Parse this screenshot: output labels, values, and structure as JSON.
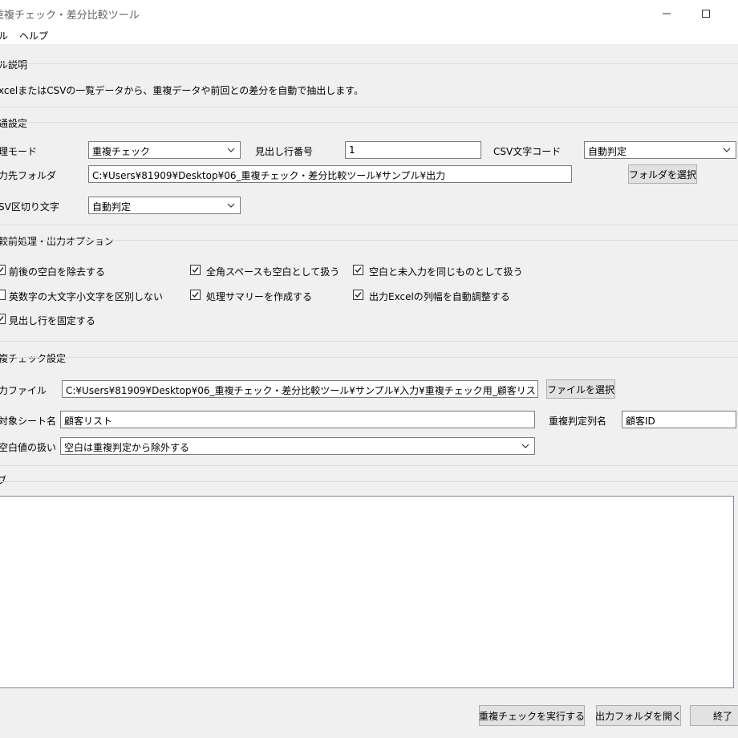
{
  "window": {
    "title": "重複チェック・差分比較ツール"
  },
  "menu": {
    "items": [
      "ル",
      "ヘルプ"
    ]
  },
  "description": {
    "title": "ル説明",
    "text": "xcelまたはCSVの一覧データから、重複データや前回との差分を自動で抽出します。"
  },
  "common": {
    "title": "通設定",
    "mode_label": "理モード",
    "mode_value": "重複チェック",
    "header_row_label": "見出し行番号",
    "header_row_value": "1",
    "encoding_label": "CSV文字コード",
    "encoding_value": "自動判定",
    "output_label": "力先フォルダ",
    "output_value": "C:¥Users¥81909¥Desktop¥06_重複チェック・差分比較ツール¥サンプル¥出力",
    "folder_button": "フォルダを選択",
    "delimiter_label": "SV区切り文字",
    "delimiter_value": "自動判定"
  },
  "options": {
    "title": "較前処理・出力オプション",
    "items": [
      {
        "label": "前後の空白を除去する",
        "checked": true
      },
      {
        "label": "全角スペースも空白として扱う",
        "checked": true
      },
      {
        "label": "空白と未入力を同じものとして扱う",
        "checked": true
      },
      {
        "label": "英数字の大文字小文字を区別しない",
        "checked": false
      },
      {
        "label": "処理サマリーを作成する",
        "checked": true
      },
      {
        "label": "出力Excelの列幅を自動調整する",
        "checked": true
      },
      {
        "label": "見出し行を固定する",
        "checked": true
      }
    ]
  },
  "dup": {
    "title": "複チェック設定",
    "input_label": "力ファイル",
    "input_value": "C:¥Users¥81909¥Desktop¥06_重複チェック・差分比較ツール¥サンプル¥入力¥重複チェック用_顧客リスト.xlsx",
    "file_button": "ファイルを選択",
    "sheet_label": "対象シート名",
    "sheet_value": "顧客リスト",
    "key_label": "重複判定列名",
    "key_value": "顧客ID",
    "blank_label": "空白値の扱い",
    "blank_value": "空白は重複判定から除外する"
  },
  "log": {
    "title": "ブ"
  },
  "footer": {
    "run_button": "重複チェックを実行する",
    "open_button": "出力フォルダを開く",
    "exit_button": "終了"
  }
}
